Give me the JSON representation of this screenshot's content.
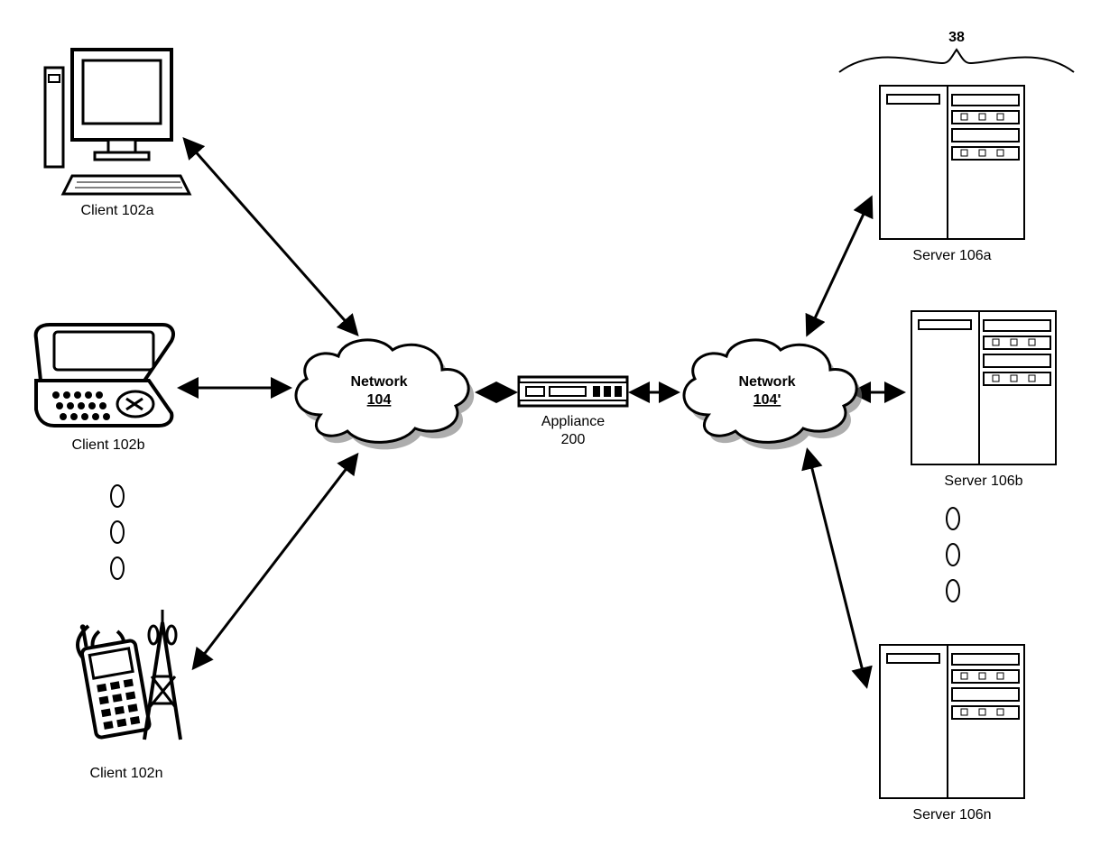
{
  "clients": {
    "a": {
      "label": "Client 102a"
    },
    "b": {
      "label": "Client 102b"
    },
    "n": {
      "label": "Client 102n"
    }
  },
  "servers": {
    "a": {
      "label": "Server 106a"
    },
    "b": {
      "label": "Server 106b"
    },
    "n": {
      "label": "Server 106n"
    }
  },
  "networks": {
    "left": {
      "title": "Network",
      "id": "104"
    },
    "right": {
      "title": "Network",
      "id": "104'"
    }
  },
  "appliance": {
    "title": "Appliance",
    "id": "200"
  },
  "group_label": "38"
}
